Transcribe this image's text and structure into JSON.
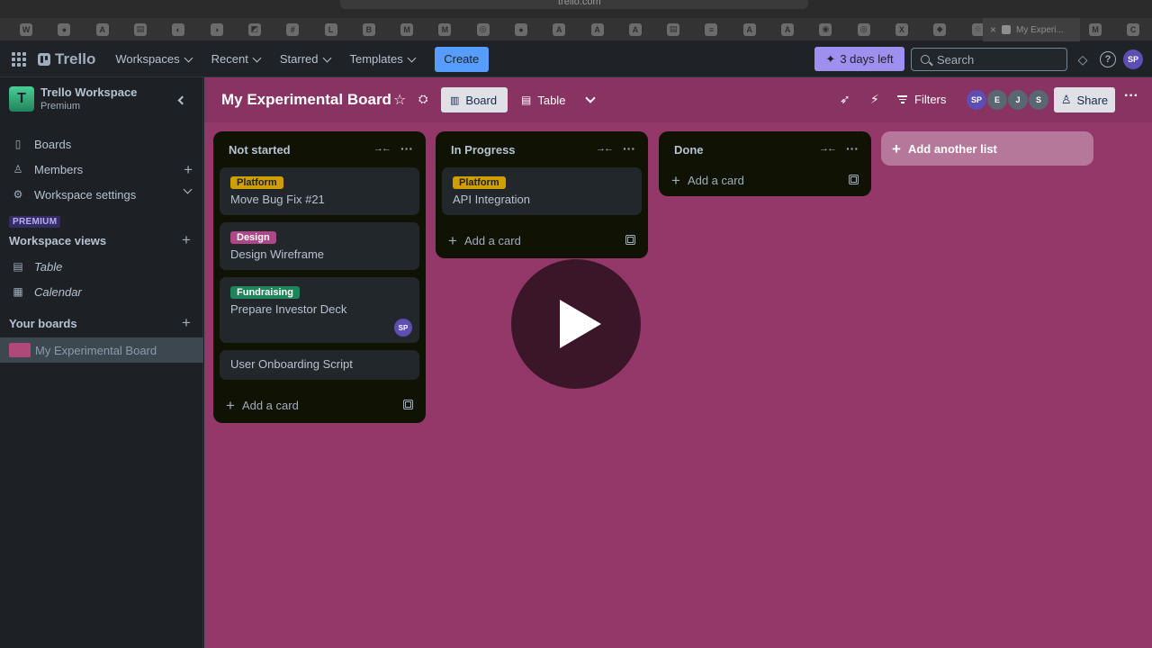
{
  "browser": {
    "url": "trello.com",
    "tab_icons": [
      "W",
      "●",
      "A",
      "▤",
      "◐",
      "◑",
      "◩",
      "#",
      "L",
      "B",
      "M",
      "M",
      "◎",
      "●",
      "A",
      "A",
      "A",
      "▤",
      "≡",
      "A",
      "A",
      "◉",
      "◎",
      "X",
      "◆",
      "☆"
    ],
    "active_tab_title": "My Experi...",
    "extra_tab_icons": [
      "M",
      "C"
    ]
  },
  "header": {
    "logo": "Trello",
    "nav": [
      "Workspaces",
      "Recent",
      "Starred",
      "Templates"
    ],
    "create_label": "Create",
    "trial_label": "3 days left",
    "search_placeholder": "Search",
    "user_initials": "SP"
  },
  "sidebar": {
    "workspace_initial": "T",
    "workspace_name": "Trello Workspace",
    "workspace_plan": "Premium",
    "items": [
      {
        "label": "Boards",
        "icon": "board-icon"
      },
      {
        "label": "Members",
        "icon": "person-icon"
      },
      {
        "label": "Workspace settings",
        "icon": "gear-icon"
      }
    ],
    "premium_tag": "PREMIUM",
    "views_heading": "Workspace views",
    "views": [
      {
        "label": "Table",
        "icon": "table-icon"
      },
      {
        "label": "Calendar",
        "icon": "calendar-icon"
      }
    ],
    "boards_heading": "Your boards",
    "boards": [
      {
        "label": "My Experimental Board",
        "color": "#b0487a"
      }
    ]
  },
  "board": {
    "title": "My Experimental Board",
    "background": "#94386a",
    "view_board": "Board",
    "view_table": "Table",
    "filters_label": "Filters",
    "share_label": "Share",
    "members": [
      {
        "initials": "SP",
        "color": "#5e4db2"
      },
      {
        "initials": "E",
        "color": "#596773"
      },
      {
        "initials": "J",
        "color": "#596773"
      },
      {
        "initials": "S",
        "color": "#596773"
      }
    ],
    "add_list_label": "Add another list",
    "add_card_label": "Add a card",
    "lists": [
      {
        "title": "Not started",
        "cards": [
          {
            "label": "Platform",
            "label_color": "#cf9f02",
            "title": "Move Bug Fix #21"
          },
          {
            "label": "Design",
            "label_color": "#ae4787",
            "title": "Design Wireframe"
          },
          {
            "label": "Fundraising",
            "label_color": "#1f845a",
            "title": "Prepare Investor Deck",
            "member": "SP"
          },
          {
            "title": "User Onboarding Script"
          }
        ]
      },
      {
        "title": "In Progress",
        "cards": [
          {
            "label": "Platform",
            "label_color": "#cf9f02",
            "title": "API Integration"
          }
        ]
      },
      {
        "title": "Done",
        "cards": []
      }
    ]
  }
}
